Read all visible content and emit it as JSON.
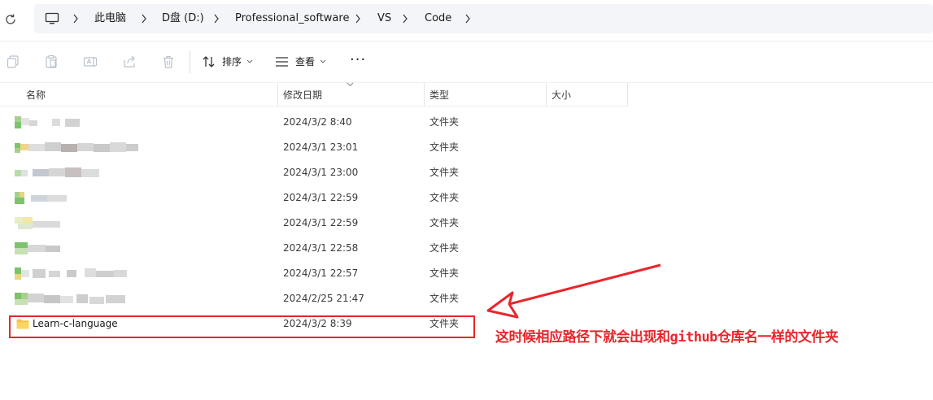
{
  "address_bar": {
    "crumbs": [
      "此电脑",
      "D盘 (D:)",
      "Professional_software",
      "VS",
      "Code"
    ]
  },
  "toolbar": {
    "sort_label": "排序",
    "view_label": "查看",
    "more_label": "···"
  },
  "columns": {
    "name": "名称",
    "date": "修改日期",
    "type": "类型",
    "size": "大小"
  },
  "rows": [
    {
      "date": "2024/3/2 8:40",
      "type": "文件夹"
    },
    {
      "date": "2024/3/1 23:01",
      "type": "文件夹"
    },
    {
      "date": "2024/3/1 23:00",
      "type": "文件夹"
    },
    {
      "date": "2024/3/1 22:59",
      "type": "文件夹"
    },
    {
      "date": "2024/3/1 22:59",
      "type": "文件夹"
    },
    {
      "date": "2024/3/1 22:58",
      "type": "文件夹"
    },
    {
      "date": "2024/3/1 22:57",
      "type": "文件夹"
    },
    {
      "date": "2024/2/25 21:47",
      "type": "文件夹"
    },
    {
      "name": "Learn-c-language",
      "date": "2024/3/2 8:39",
      "type": "文件夹"
    }
  ],
  "annotation": {
    "text": "这时候相应路径下就会出现和github仓库名一样的文件夹",
    "color": "#e8262c"
  },
  "icons": {
    "refresh": "refresh-icon",
    "computer": "computer-icon",
    "copy": "copy-icon",
    "paste": "paste-icon",
    "rename": "rename-icon",
    "share": "share-icon",
    "delete": "delete-icon",
    "sort": "sort-icon",
    "view": "view-icon",
    "folder": "folder-icon"
  }
}
